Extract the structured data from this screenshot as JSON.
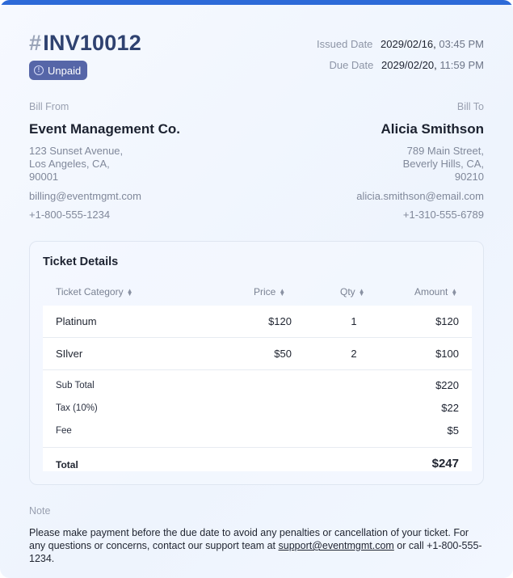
{
  "invoice": {
    "hash": "#",
    "number": "INV10012",
    "status": "Unpaid",
    "status_icon": "info-circle-icon",
    "issued_label": "Issued Date",
    "issued_date": "2029/02/16,",
    "issued_time": "03:45 PM",
    "due_label": "Due Date",
    "due_date": "2029/02/20,",
    "due_time": "11:59 PM"
  },
  "bill_from": {
    "caption": "Bill From",
    "name": "Event Management Co.",
    "address": "123 Sunset Avenue,\nLos Angeles, CA,\n90001",
    "email": "billing@eventmgmt.com",
    "phone": "+1-800-555-1234"
  },
  "bill_to": {
    "caption": "Bill To",
    "name": "Alicia Smithson",
    "address": "789 Main Street,\nBeverly Hills, CA,\n90210",
    "email": "alicia.smithson@email.com",
    "phone": "+1-310-555-6789"
  },
  "tickets": {
    "title": "Ticket Details",
    "columns": [
      "Ticket Category",
      "Price",
      "Qty",
      "Amount"
    ],
    "rows": [
      {
        "category": "Platinum",
        "price": "$120",
        "qty": "1",
        "amount": "$120"
      },
      {
        "category": "SIlver",
        "price": "$50",
        "qty": "2",
        "amount": "$100"
      }
    ],
    "subtotal_label": "Sub Total",
    "subtotal": "$220",
    "tax_label": "Tax (10%)",
    "tax": "$22",
    "fee_label": "Fee",
    "fee": "$5",
    "total_label": "Total",
    "total": "$247"
  },
  "note": {
    "caption": "Note",
    "text_before": "Please make payment before the due date to avoid any penalties or cancellation of your ticket. For any questions or concerns, contact our support team at ",
    "link": "support@eventmgmt.com",
    "text_after": " or call +1-800-555-1234."
  },
  "colors": {
    "accent": "#2d6ad8",
    "badge": "#5666a8",
    "title": "#2f4270"
  }
}
